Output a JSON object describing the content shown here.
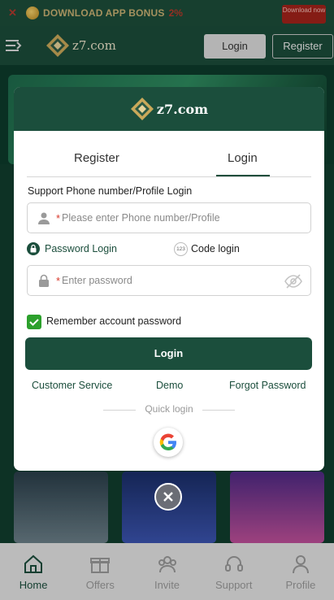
{
  "top_banner": {
    "text": "DOWNLOAD APP BONUS",
    "amount": "2%",
    "download_label": "Download now"
  },
  "header": {
    "logo_text": "z7.com",
    "login_label": "Login",
    "register_label": "Register"
  },
  "hero": {
    "logo_text": "z7.com"
  },
  "modal": {
    "logo_text": "z7.com",
    "tabs": [
      {
        "label": "Register"
      },
      {
        "label": "Login"
      }
    ],
    "active_tab": "Login",
    "phone_label": "Support Phone number/Profile Login",
    "phone_placeholder": "Please enter Phone number/Profile",
    "required_mark": "*",
    "password_login_label": "Password Login",
    "code_badge_text": "123",
    "code_login_label": "Code login",
    "password_placeholder": "Enter password",
    "remember_label": "Remember account password",
    "remember_checked": true,
    "login_button": "Login",
    "links": {
      "customer_service": "Customer Service",
      "demo": "Demo",
      "forgot_password": "Forgot Password"
    },
    "quick_login_label": "Quick login"
  },
  "bottom_nav": [
    {
      "label": "Home",
      "icon": "home-icon",
      "active": true
    },
    {
      "label": "Offers",
      "icon": "gift-icon",
      "active": false
    },
    {
      "label": "Invite",
      "icon": "invite-icon",
      "active": false
    },
    {
      "label": "Support",
      "icon": "headset-icon",
      "active": false
    },
    {
      "label": "Profile",
      "icon": "profile-icon",
      "active": false
    }
  ],
  "colors": {
    "brand_green": "#1b4e3c",
    "checkbox_green": "#2ca02c",
    "required_red": "#d8392b"
  }
}
